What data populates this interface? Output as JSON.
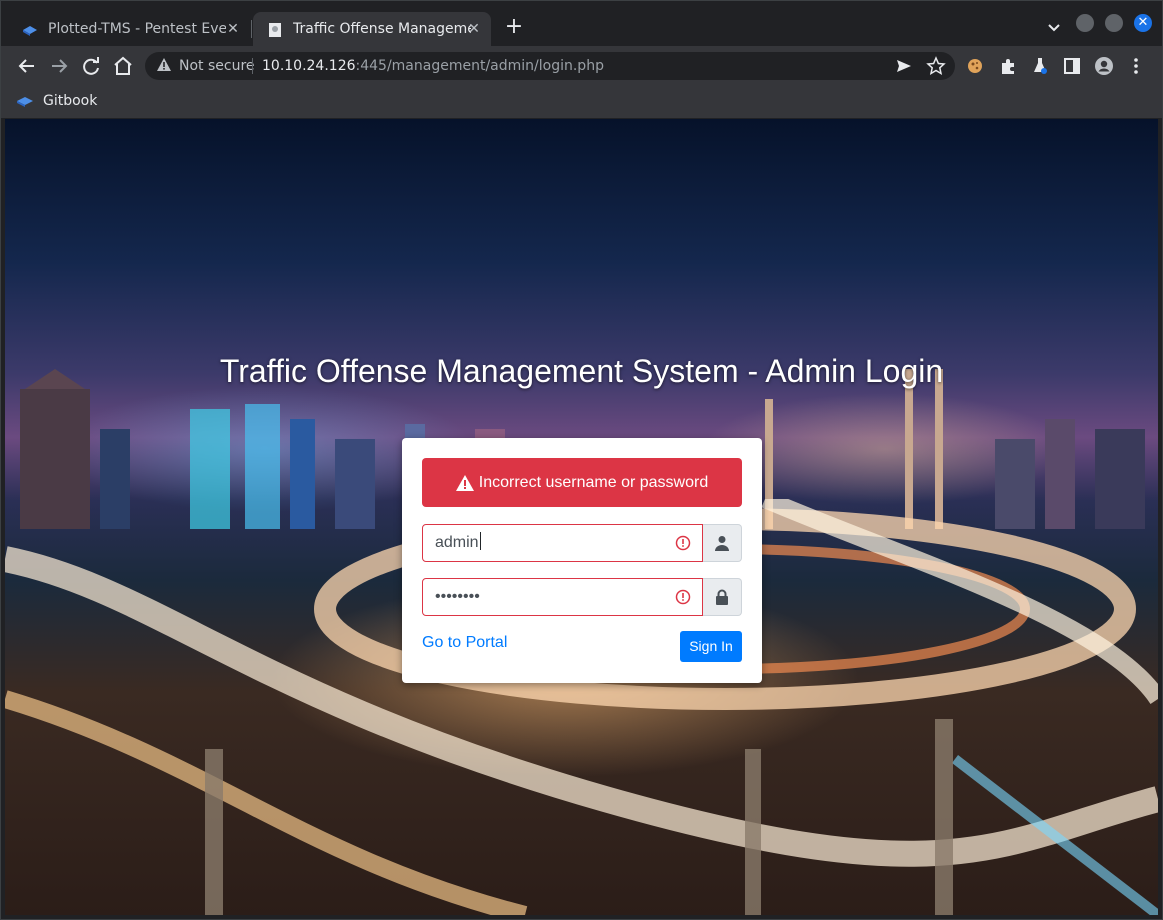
{
  "browser": {
    "tabs": [
      {
        "title": "Plotted-TMS - Pentest Eve",
        "active": false
      },
      {
        "title": "Traffic Offense Manageme",
        "active": true
      }
    ],
    "address": {
      "security_label": "Not secure",
      "host": "10.10.24.126",
      "path": ":445/management/admin/login.php"
    },
    "bookmarks": [
      {
        "label": "Gitbook"
      }
    ],
    "accent_color": "#1a73e8"
  },
  "page": {
    "title": "Traffic Offense Management System - Admin Login",
    "alert": {
      "text": "Incorrect username or password",
      "color": "#dc3545"
    },
    "username": {
      "value": "admin",
      "icon": "user-icon"
    },
    "password": {
      "value": "••••••••",
      "icon": "lock-icon"
    },
    "portal_link": "Go to Portal",
    "signin_label": "Sign In",
    "primary_color": "#007bff"
  }
}
